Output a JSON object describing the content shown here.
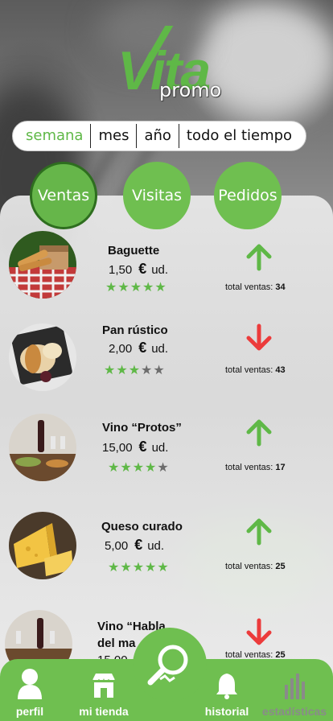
{
  "brand": {
    "logo_main": "Vita",
    "logo_sub": "promo"
  },
  "period": {
    "options": [
      "semana",
      "mes",
      "año",
      "todo el tiempo"
    ],
    "selected": "semana"
  },
  "tabs": [
    {
      "label": "Ventas",
      "active": true
    },
    {
      "label": "Visitas",
      "active": false
    },
    {
      "label": "Pedidos",
      "active": false
    }
  ],
  "products": [
    {
      "name": "Baguette",
      "price": "1,50",
      "currency": "€",
      "unit": "ud.",
      "rating": 5,
      "trend": "up",
      "total_label": "total ventas:",
      "total": "34"
    },
    {
      "name": "Pan rústico",
      "price": "2,00",
      "currency": "€",
      "unit": "ud.",
      "rating": 3,
      "trend": "down",
      "total_label": "total ventas:",
      "total": "43"
    },
    {
      "name": "Vino “Protos”",
      "price": "15,00",
      "currency": "€",
      "unit": "ud.",
      "rating": 4,
      "trend": "up",
      "total_label": "total ventas:",
      "total": "17"
    },
    {
      "name": "Queso curado",
      "price": "5,00",
      "currency": "€",
      "unit": "ud.",
      "rating": 5,
      "trend": "up",
      "total_label": "total ventas:",
      "total": "25"
    },
    {
      "name_line1": "Vino “Habla",
      "name_line2": "del ma",
      "price": "15,00",
      "trend": "down",
      "total_label": "total ventas:",
      "total": "25"
    }
  ],
  "nav": {
    "profile": "perfil",
    "shop": "mi tienda",
    "history": "historial",
    "stats": "estadísticas"
  },
  "colors": {
    "accent": "#6fbf50",
    "up": "#5fb847",
    "down": "#ec3b3b"
  },
  "icons": {
    "up": "arrow-up-icon",
    "down": "arrow-down-icon",
    "search": "search-icon",
    "profile": "person-icon",
    "shop": "shop-icon",
    "history": "bell-icon",
    "stats": "bar-chart-icon"
  }
}
